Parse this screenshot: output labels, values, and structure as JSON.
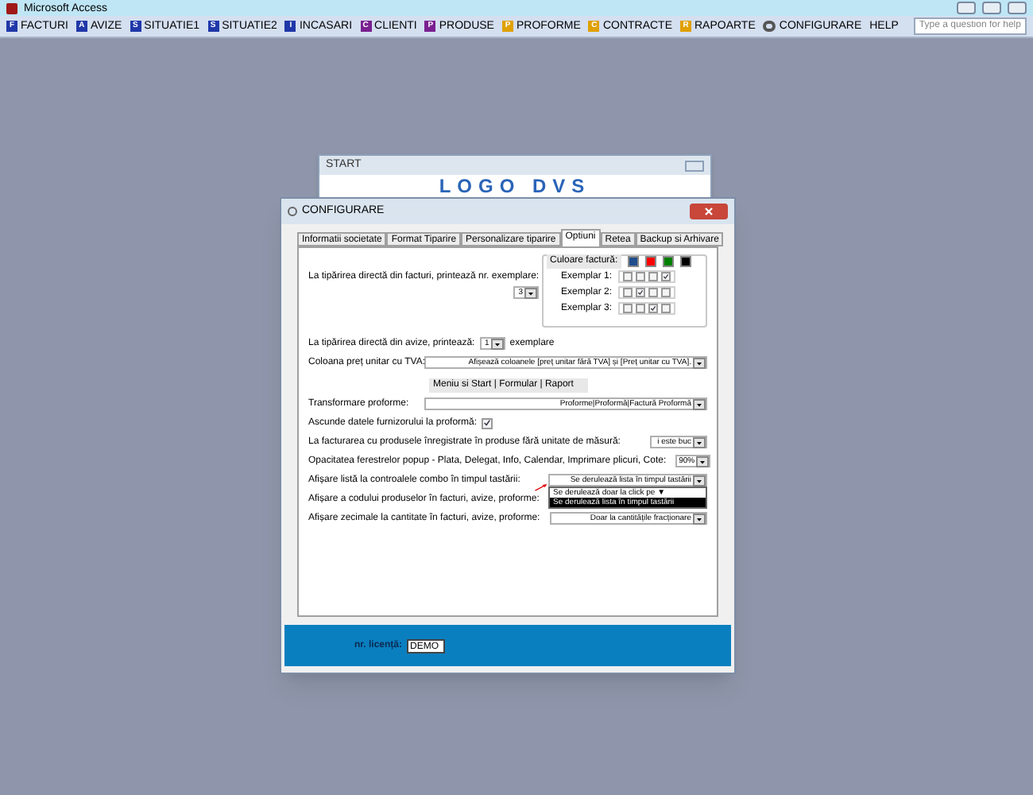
{
  "window": {
    "title": "Microsoft Access"
  },
  "menu": [
    {
      "label": "FACTURI",
      "icon": "F",
      "color": "#2038a8"
    },
    {
      "label": "AVIZE",
      "icon": "A",
      "color": "#2038a8"
    },
    {
      "label": "SITUATIE1",
      "icon": "S",
      "color": "#2038a8"
    },
    {
      "label": "SITUATIE2",
      "icon": "S",
      "color": "#2038a8"
    },
    {
      "label": "INCASARI",
      "icon": "I",
      "color": "#2038a8"
    },
    {
      "label": "CLIENTI",
      "icon": "C",
      "color": "#7a2090"
    },
    {
      "label": "PRODUSE",
      "icon": "P",
      "color": "#7a2090"
    },
    {
      "label": "PROFORME",
      "icon": "P",
      "color": "#e0a000"
    },
    {
      "label": "CONTRACTE",
      "icon": "C",
      "color": "#e0a000"
    },
    {
      "label": "RAPOARTE",
      "icon": "R",
      "color": "#e0a000"
    },
    {
      "label": "CONFIGURARE",
      "color": "#555555"
    },
    {
      "label": "HELP",
      "color": "#000000"
    }
  ],
  "help_box": {
    "placeholder": "Type a question for help"
  },
  "start_window": {
    "title": "START",
    "logo": "LOGO DVS"
  },
  "dialog": {
    "title": "CONFIGURARE",
    "tabs": [
      {
        "label": "Informatii societate",
        "selected": false
      },
      {
        "label": "Format Tiparire",
        "selected": false
      },
      {
        "label": "Personalizare tiparire",
        "selected": false
      },
      {
        "label": "Optiuni",
        "selected": true
      },
      {
        "label": "Retea",
        "selected": false
      },
      {
        "label": "Backup si Arhivare",
        "selected": false
      }
    ],
    "invoice_copies": {
      "label": "La tipărirea directă din facturi, printează nr. exemplare:",
      "value": "3"
    },
    "invoice_colors": {
      "label": "Culoare factură:",
      "swatches": [
        {
          "color": "#1f4e8c"
        },
        {
          "color": "#ff0000"
        },
        {
          "color": "#008000"
        },
        {
          "color": "#000000"
        }
      ],
      "copies": [
        {
          "label": "Exemplar 1:",
          "checks": [
            false,
            false,
            false,
            true
          ]
        },
        {
          "label": "Exemplar 2:",
          "checks": [
            false,
            true,
            false,
            false
          ]
        },
        {
          "label": "Exemplar 3:",
          "checks": [
            false,
            false,
            true,
            false
          ]
        }
      ]
    },
    "rows": [
      {
        "kind": "number",
        "label": "La tipărirea directă din avize, printează:",
        "value": "1",
        "suffix": "exemplare"
      },
      {
        "kind": "wide",
        "label": "Coloana preț unitar cu TVA:",
        "value": "Afișează coloanele [preț unitar fără TVA] și [Preț unitar cu TVA]."
      },
      {
        "kind": "heading",
        "label": "Meniu si Start | Formular | Raport"
      },
      {
        "kind": "wide",
        "label": "Transformare proforme:",
        "value": "Proforme|Proformă|Factură Proformă"
      },
      {
        "kind": "checkbox",
        "label": "Ascunde datele furnizorului la proformă:",
        "checked": true
      },
      {
        "kind": "short",
        "label": "La facturarea cu produsele înregistrate în produse fără unitate de măsură:",
        "value": "i este buc"
      },
      {
        "kind": "short",
        "label": "Opacitatea ferestrelor popup - Plata, Delegat, Info, Calendar, Imprimare plicuri, Cote:",
        "value": "90%"
      },
      {
        "kind": "medium",
        "label": "Afișare listă la controalele combo în timpul tastării:",
        "value": "Se derulează lista în timpul tastării",
        "open": true,
        "options": [
          {
            "label": "Se derulează doar la click pe ▼",
            "selected": false
          },
          {
            "label": "Se derulează lista în timpul tastării",
            "selected": true
          }
        ]
      },
      {
        "kind": "medium",
        "label": "Afișare a codului produselor în facturi, avize, proforme:"
      },
      {
        "kind": "medium",
        "label": "Afișare zecimale la cantitate în facturi, avize, proforme:",
        "value": "Doar la cantitățile fracționare"
      }
    ],
    "license": {
      "label": "nr. licență:",
      "value": "DEMO"
    }
  }
}
